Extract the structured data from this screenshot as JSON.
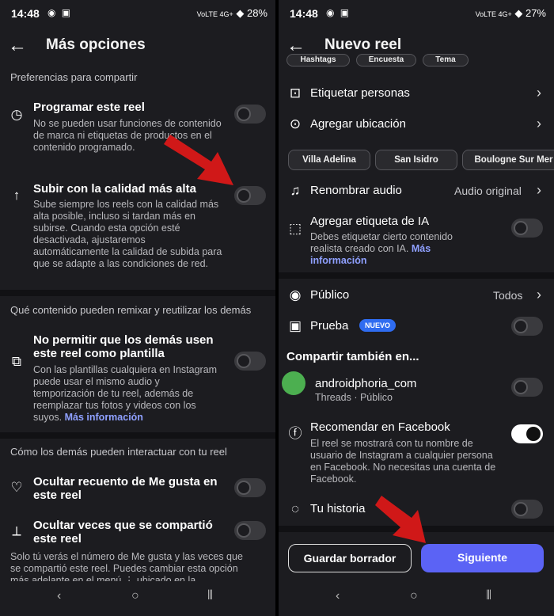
{
  "left": {
    "status": {
      "time": "14:48",
      "indicators": "VoLTE 4G+",
      "battery": "28%"
    },
    "title": "Más opciones",
    "section1": "Preferencias para compartir",
    "schedule": {
      "title": "Programar este reel",
      "desc": "No se pueden usar funciones de contenido de marca ni etiquetas de productos en el contenido programado.",
      "on": false
    },
    "quality": {
      "title": "Subir con la calidad más alta",
      "desc": "Sube siempre los reels con la calidad más alta posible, incluso si tardan más en subirse. Cuando esta opción esté desactivada, ajustaremos automáticamente la calidad de subida para que se adapte a las condiciones de red.",
      "on": false
    },
    "section2": "Qué contenido pueden remixar y reutilizar los demás",
    "template": {
      "title": "No permitir que los demás usen este reel como plantilla",
      "desc": "Con las plantillas cualquiera en Instagram puede usar el mismo audio y temporización de tu reel, además de reemplazar tus fotos y videos con los suyos.",
      "link": "Más información",
      "on": false
    },
    "section3": "Cómo los demás pueden interactuar con tu reel",
    "likes": {
      "title": "Ocultar recuento de Me gusta en este reel",
      "on": false
    },
    "shares": {
      "title": "Ocultar veces que se compartió este reel",
      "on": false
    },
    "footer": "Solo tú verás el número de Me gusta y las veces que se compartió este reel. Puedes cambiar esta opción más adelante en el menú ⋮ ubicado en la"
  },
  "right": {
    "status": {
      "time": "14:48",
      "indicators": "VoLTE 4G+",
      "battery": "27%"
    },
    "title": "Nuevo reel",
    "top_chips": [
      "Hashtags",
      "Encuesta",
      "Tema"
    ],
    "tag_people": "Etiquetar personas",
    "add_location": "Agregar ubicación",
    "location_chips": [
      "Villa Adelina",
      "San Isidro",
      "Boulogne Sur Mer"
    ],
    "rename_audio": {
      "label": "Renombrar audio",
      "value": "Audio original"
    },
    "ai_label": {
      "title": "Agregar etiqueta de IA",
      "desc": "Debes etiquetar cierto contenido realista creado con IA.",
      "link": "Más información",
      "on": false
    },
    "audience": {
      "label": "Público",
      "value": "Todos"
    },
    "trial": {
      "label": "Prueba",
      "badge": "NUEVO",
      "on": false
    },
    "share_also": "Compartir también en...",
    "threads": {
      "name": "androidphoria_com",
      "sub": "Threads · Público",
      "on": false
    },
    "facebook": {
      "title": "Recomendar en Facebook",
      "desc": "El reel se mostrará con tu nombre de usuario de Instagram a cualquier persona en Facebook. No necesitas una cuenta de Facebook.",
      "on": true
    },
    "story": {
      "label": "Tu historia",
      "on": false
    },
    "save_draft": "Guardar borrador",
    "next": "Siguiente"
  },
  "colors": {
    "background": "#1c1c20",
    "accent": "#5b63f5",
    "link": "#8fa0ff",
    "badge": "#2f6cf0",
    "arrow": "#d01818"
  }
}
